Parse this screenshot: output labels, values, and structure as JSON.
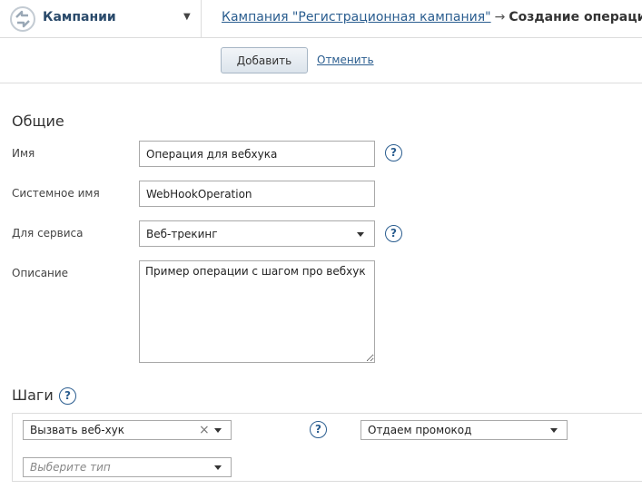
{
  "header": {
    "section_title": "Кампании",
    "breadcrumb_link": "Кампания \"Регистрационная кампания\"",
    "breadcrumb_arrow": "→",
    "breadcrumb_current": "Создание операции"
  },
  "toolbar": {
    "add_label": "Добавить",
    "cancel_label": "Отменить"
  },
  "general": {
    "heading": "Общие",
    "name_label": "Имя",
    "name_value": "Операция для вебхука",
    "system_name_label": "Системное имя",
    "system_name_value": "WebHookOperation",
    "service_label": "Для сервиса",
    "service_value": "Веб-трекинг",
    "description_label": "Описание",
    "description_value": "Пример операции с шагом про вебхук"
  },
  "steps": {
    "heading": "Шаги",
    "step1_type": "Вызвать веб-хук",
    "step1_clear": "×",
    "step1_target": "Отдаем промокод",
    "new_step_placeholder": "Выберите тип"
  },
  "help_glyph": "?",
  "colors": {
    "link": "#2a5d8f",
    "title": "#2a4a6b",
    "border": "#dcdcdc"
  }
}
